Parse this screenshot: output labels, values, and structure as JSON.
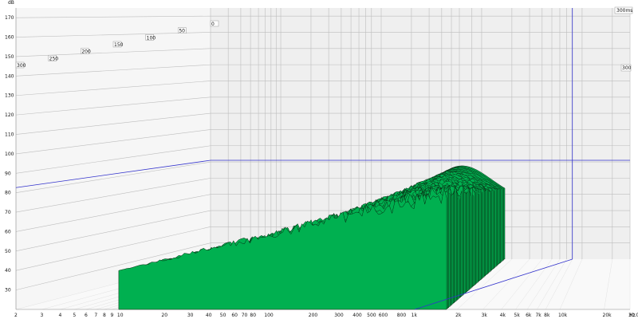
{
  "window": {
    "y_unit": "dB",
    "x_unit": "Hz",
    "time_unit_label": "300ms",
    "right_marker_label": "300"
  },
  "colors": {
    "slice_fill": "#00b050",
    "slice_stroke": "#0a2a12",
    "cursor": "#3333cc",
    "grid": "#bdbdbd",
    "back_wall": "#efefef",
    "side_wall": "#f6f6f6"
  },
  "chart_data": {
    "type": "area",
    "x_scale": "log",
    "xlim": [
      2,
      30000
    ],
    "ylim": [
      20,
      175
    ],
    "zlim": [
      0,
      300
    ],
    "y_ticks": [
      "30",
      "40",
      "50",
      "60",
      "70",
      "80",
      "90",
      "100",
      "110",
      "120",
      "130",
      "140",
      "150",
      "160",
      "170"
    ],
    "x_ticks": [
      {
        "value": 2,
        "label": "2"
      },
      {
        "value": 3,
        "label": "3"
      },
      {
        "value": 4,
        "label": "4"
      },
      {
        "value": 5,
        "label": "5"
      },
      {
        "value": 6,
        "label": "6"
      },
      {
        "value": 7,
        "label": "7"
      },
      {
        "value": 8,
        "label": "8"
      },
      {
        "value": 9,
        "label": "9"
      },
      {
        "value": 10,
        "label": "10"
      },
      {
        "value": 20,
        "label": "20"
      },
      {
        "value": 30,
        "label": "30"
      },
      {
        "value": 40,
        "label": "40"
      },
      {
        "value": 50,
        "label": "50"
      },
      {
        "value": 60,
        "label": "60"
      },
      {
        "value": 70,
        "label": "70"
      },
      {
        "value": 80,
        "label": "80"
      },
      {
        "value": 100,
        "label": "100"
      },
      {
        "value": 200,
        "label": "200"
      },
      {
        "value": 300,
        "label": "300"
      },
      {
        "value": 400,
        "label": "400"
      },
      {
        "value": 500,
        "label": "500"
      },
      {
        "value": 600,
        "label": "600"
      },
      {
        "value": 800,
        "label": "800"
      },
      {
        "value": 1000,
        "label": "1k"
      },
      {
        "value": 2000,
        "label": "2k"
      },
      {
        "value": 3000,
        "label": "3k"
      },
      {
        "value": 4000,
        "label": "4k"
      },
      {
        "value": 5000,
        "label": "5k"
      },
      {
        "value": 6000,
        "label": "6k"
      },
      {
        "value": 7000,
        "label": "7k"
      },
      {
        "value": 8000,
        "label": "8k"
      },
      {
        "value": 10000,
        "label": "10k"
      },
      {
        "value": 20000,
        "label": "20k"
      },
      {
        "value": 30000,
        "label": "30.0k"
      }
    ],
    "time_ticks": [
      "0",
      "50",
      "100",
      "150",
      "200",
      "250",
      "300"
    ],
    "slice_count": 55,
    "slice_freq_range": [
      10,
      1700
    ],
    "cursor": {
      "freq_hz": 8000,
      "level_db": 81
    },
    "notes_levels_db": {
      "front_low": 40,
      "front_high": 80,
      "back_peak": 103
    }
  }
}
